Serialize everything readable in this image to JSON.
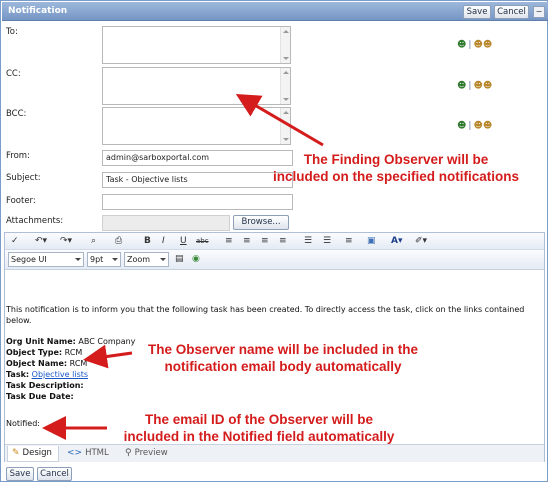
{
  "window": {
    "title": "Notification",
    "save_label": "Save",
    "cancel_label": "Cancel",
    "minimize_glyph": "−"
  },
  "form": {
    "to_label": "To:",
    "cc_label": "CC:",
    "bcc_label": "BCC:",
    "from_label": "From:",
    "from_value": "admin@sarboxportal.com",
    "subject_label": "Subject:",
    "subject_value": "Task - Objective lists",
    "footer_label": "Footer:",
    "footer_value": "",
    "attachments_label": "Attachments:",
    "browse_label": "Browse...",
    "user_icon": "user-icon",
    "users_icon": "users-icon",
    "separator": "|"
  },
  "editor": {
    "toolbar1": [
      {
        "name": "spellcheck-icon",
        "glyph": "✓"
      },
      {
        "name": "undo-icon",
        "glyph": "↶▾"
      },
      {
        "name": "redo-icon",
        "glyph": "↷▾"
      },
      {
        "name": "find-icon",
        "glyph": "⌕"
      },
      {
        "name": "print-icon",
        "glyph": "⎙"
      },
      {
        "name": "bold-icon",
        "glyph": "B"
      },
      {
        "name": "italic-icon",
        "glyph": "I"
      },
      {
        "name": "underline-icon",
        "glyph": "U"
      },
      {
        "name": "strikethrough-icon",
        "glyph": "abc"
      },
      {
        "name": "align-left-icon",
        "glyph": "≡"
      },
      {
        "name": "align-center-icon",
        "glyph": "≡"
      },
      {
        "name": "align-right-icon",
        "glyph": "≡"
      },
      {
        "name": "justify-icon",
        "glyph": "≡"
      },
      {
        "name": "numbered-list-icon",
        "glyph": "☰"
      },
      {
        "name": "bulleted-list-icon",
        "glyph": "☰"
      },
      {
        "name": "paragraph-icon",
        "glyph": "≡"
      },
      {
        "name": "insert-image-icon",
        "glyph": "▣"
      },
      {
        "name": "font-color-icon",
        "glyph": "A▾"
      },
      {
        "name": "highlight-icon",
        "glyph": "✐▾"
      }
    ],
    "font_family": "Segoe UI",
    "font_size": "9pt",
    "zoom": "Zoom",
    "intro": "This notification is to inform you that the following task has been created. To directly access the task, click on the links contained",
    "intro_cont": "below.",
    "org_unit_label": "Org Unit Name:",
    "org_unit_value": "ABC Company",
    "object_type_label": "Object Type:",
    "object_type_value": "RCM",
    "object_name_label": "Object Name:",
    "object_name_value": "RCM",
    "task_label": "Task:",
    "task_value": "Objective lists",
    "task_desc_label": "Task Description:",
    "task_due_label": "Task Due Date:",
    "notified_label": "Notified:",
    "modes": {
      "design": "Design",
      "html": "HTML",
      "preview": "Preview"
    }
  },
  "bottom": {
    "save_label": "Save",
    "cancel_label": "Cancel"
  },
  "annotations": {
    "a1_line1": "The Finding Observer will be",
    "a1_line2": "included on the specified notifications",
    "a2_line1": "The Observer name will be included in the",
    "a2_line2": "notification email body automatically",
    "a3_line1": "The email ID of the Observer will be",
    "a3_line2": "included in the Notified field automatically"
  },
  "colors": {
    "annotation": "#d41c1c",
    "title_bar": "#7d9cc9",
    "link": "#1a56c8"
  }
}
